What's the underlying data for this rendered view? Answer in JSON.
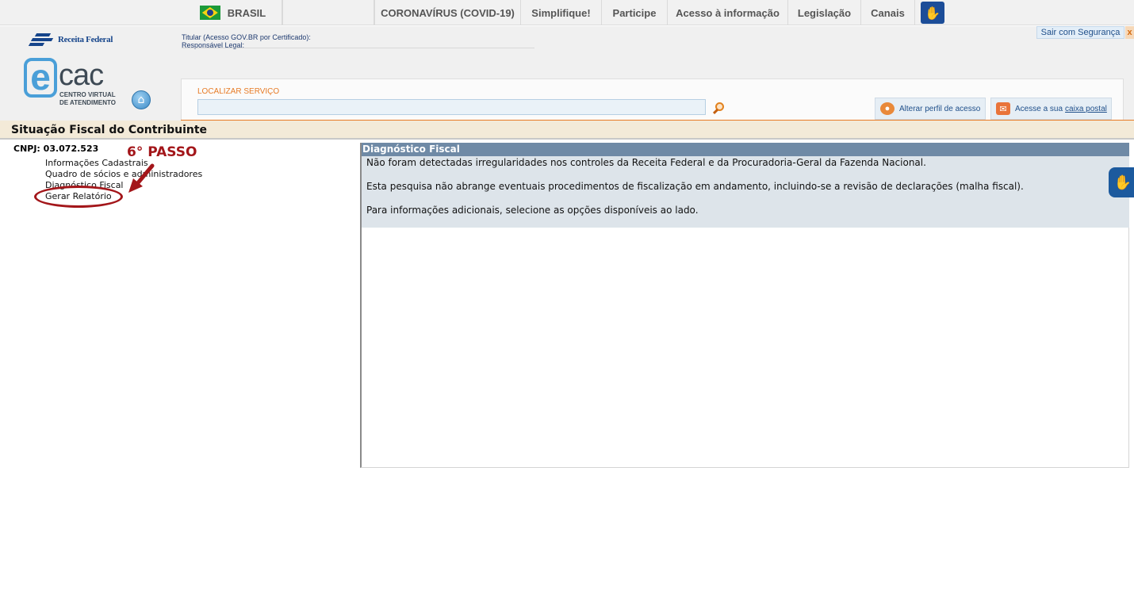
{
  "govbar": {
    "brasil": "BRASIL",
    "covid": "CORONAVÍRUS (COVID-19)",
    "simplifique": "Simplifique!",
    "participe": "Participe",
    "acesso": "Acesso à informação",
    "legislacao": "Legislação",
    "canais": "Canais"
  },
  "header": {
    "rf_logo_text": "Receita Federal",
    "ecac_e": "e",
    "ecac_cac": "cac",
    "ecac_sub": "CENTRO VIRTUAL DE ATENDIMENTO",
    "titular": "Titular (Acesso GOV.BR por Certificado):",
    "responsavel": "Responsável Legal:",
    "sair": "Sair com Segurança",
    "sair_close": "x",
    "search_label": "LOCALIZAR SERVIÇO",
    "search_value": "",
    "perfil_button": "Alterar perfil de acesso",
    "caixa_prefix": "Acesse a sua",
    "caixa_link": "caixa postal"
  },
  "page": {
    "title": "Situação Fiscal do Contribuinte",
    "cnpj": "CNPJ: 03.072.523"
  },
  "nav": {
    "items": [
      "Informações Cadastrais",
      "Quadro de sócios e administradores",
      "Diagnóstico Fiscal",
      "Gerar Relatório"
    ]
  },
  "annotation": {
    "step": "6° PASSO",
    "color": "#a3161a"
  },
  "diagnostico": {
    "header": "Diagnóstico Fiscal",
    "lines": [
      "Não foram detectadas irregularidades nos controles da Receita Federal e da Procuradoria-Geral da Fazenda Nacional.",
      "Esta pesquisa não abrange eventuais procedimentos de fiscalização em andamento, incluindo-se a revisão de declarações (malha fiscal).",
      "Para informações adicionais, selecione as opções disponíveis ao lado."
    ]
  },
  "colors": {
    "accent_orange": "#e77b26",
    "covid_red": "#d8191f",
    "panel_header": "#6f8aa6",
    "brand_blue": "#16458b"
  }
}
